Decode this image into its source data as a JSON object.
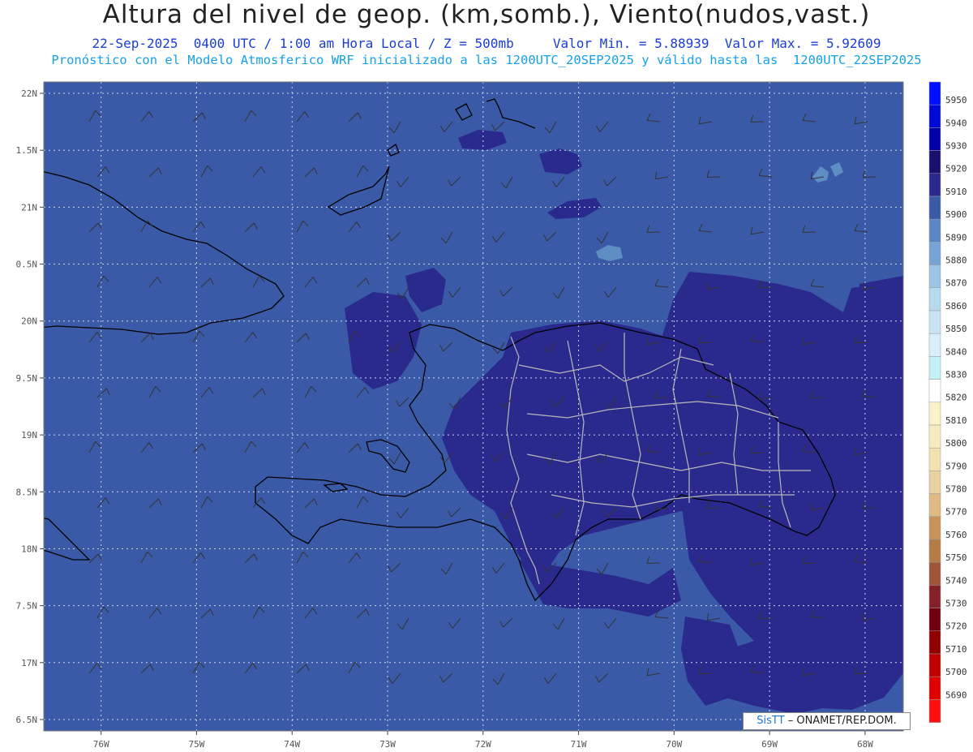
{
  "header": {
    "title": "Altura del nivel de geop. (km,somb.), Viento(nudos,vast.)",
    "line1": "22-Sep-2025  0400 UTC / 1:00 am Hora Local / Z = 500mb     Valor Min. = 5.88939  Valor Max. = 5.92609",
    "line2": "Pronóstico con el Modelo Atmosferico WRF inicializado a las 1200UTC_20SEP2025 y válido hasta las  1200UTC_22SEP2025"
  },
  "map": {
    "lon_range": [
      -76.6,
      -67.6
    ],
    "lat_range": [
      16.4,
      22.1
    ],
    "lat_labels": [
      {
        "v": 22.0,
        "t": "22N"
      },
      {
        "v": 21.5,
        "t": "1.5N"
      },
      {
        "v": 21.0,
        "t": "21N"
      },
      {
        "v": 20.5,
        "t": "0.5N"
      },
      {
        "v": 20.0,
        "t": "20N"
      },
      {
        "v": 19.5,
        "t": "9.5N"
      },
      {
        "v": 19.0,
        "t": "19N"
      },
      {
        "v": 18.5,
        "t": "8.5N"
      },
      {
        "v": 18.0,
        "t": "18N"
      },
      {
        "v": 17.5,
        "t": "7.5N"
      },
      {
        "v": 17.0,
        "t": "17N"
      },
      {
        "v": 16.5,
        "t": "6.5N"
      }
    ],
    "lon_labels": [
      {
        "v": -76,
        "t": "76W"
      },
      {
        "v": -75,
        "t": "75W"
      },
      {
        "v": -74,
        "t": "74W"
      },
      {
        "v": -73,
        "t": "73W"
      },
      {
        "v": -72,
        "t": "72W"
      },
      {
        "v": -71,
        "t": "71W"
      },
      {
        "v": -70,
        "t": "70W"
      },
      {
        "v": -69,
        "t": "69W"
      },
      {
        "v": -68,
        "t": "68W"
      }
    ],
    "colors": {
      "background": "#3a5aa8",
      "level_5910": "#2a2a8e",
      "level_5890": "#5f8ec4",
      "grid": "#cfd6ec",
      "coast": "#000000",
      "borders": "#b8b8b8"
    }
  },
  "colorbar": {
    "levels": [
      {
        "v": "5950",
        "c": "#0010ff"
      },
      {
        "v": "5940",
        "c": "#0008d8"
      },
      {
        "v": "5930",
        "c": "#0000a8"
      },
      {
        "v": "5920",
        "c": "#1a1070"
      },
      {
        "v": "5910",
        "c": "#2a2a8e"
      },
      {
        "v": "5900",
        "c": "#3a5aa8"
      },
      {
        "v": "5890",
        "c": "#5a86c4"
      },
      {
        "v": "5880",
        "c": "#75a4d4"
      },
      {
        "v": "5870",
        "c": "#9cc4e4"
      },
      {
        "v": "5860",
        "c": "#b8daee"
      },
      {
        "v": "5850",
        "c": "#c8e4f4"
      },
      {
        "v": "5840",
        "c": "#d8eef8"
      },
      {
        "v": "5830",
        "c": "#c4f0f8"
      },
      {
        "v": "5820",
        "c": "#ffffff"
      },
      {
        "v": "5810",
        "c": "#faf2c8"
      },
      {
        "v": "5800",
        "c": "#f6eac0"
      },
      {
        "v": "5790",
        "c": "#f2e2b0"
      },
      {
        "v": "5780",
        "c": "#ead2a0"
      },
      {
        "v": "5770",
        "c": "#deba84"
      },
      {
        "v": "5760",
        "c": "#c8945a"
      },
      {
        "v": "5750",
        "c": "#b47c46"
      },
      {
        "v": "5740",
        "c": "#a05438"
      },
      {
        "v": "5730",
        "c": "#84202a"
      },
      {
        "v": "5720",
        "c": "#700010"
      },
      {
        "v": "5710",
        "c": "#900000"
      },
      {
        "v": "5700",
        "c": "#c00000"
      },
      {
        "v": "5690",
        "c": "#e00000"
      },
      {
        "v": "",
        "c": "#ff1010"
      }
    ]
  },
  "credit": {
    "brand": "SisTT",
    "text": " ONAMET/REP.DOM."
  }
}
